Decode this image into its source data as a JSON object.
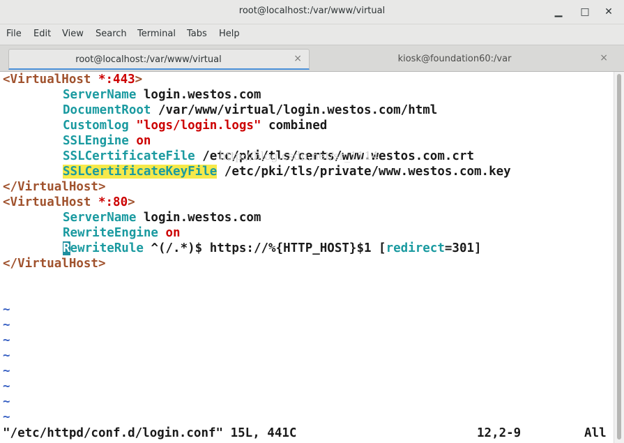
{
  "window": {
    "title": "root@localhost:/var/www/virtual",
    "minimize": "▁",
    "maximize": "□",
    "close": "✕"
  },
  "menu": [
    "File",
    "Edit",
    "View",
    "Search",
    "Terminal",
    "Tabs",
    "Help"
  ],
  "tabs": [
    {
      "label": "root@localhost:/var/www/virtual",
      "close": "×",
      "active": true
    },
    {
      "label": "kiosk@foundation60:/var",
      "close": "×",
      "active": false
    }
  ],
  "editor": {
    "l1": {
      "open": "<VirtualHost ",
      "port": "*:443",
      "end": ">"
    },
    "l2": {
      "key": "ServerName",
      "val": " login.westos.com"
    },
    "l3": {
      "key": "DocumentRoot",
      "val": " /var/www/virtual/login.westos.com/html"
    },
    "l4": {
      "key": "Customlog",
      "sp": " ",
      "str": "\"logs/login.logs\"",
      "val": " combined"
    },
    "l5": {
      "key": "SSLEngine",
      "val": " on"
    },
    "l6": {
      "key": "SSLCertificateFile",
      "val": " /etc/pki/tls/certs/www.westos.com.crt"
    },
    "l7": {
      "key": "SSLCertificateKeyFile",
      "val": " /etc/pki/tls/private/www.westos.com.key"
    },
    "l8": {
      "text": "</VirtualHost>"
    },
    "l9": {
      "open": "<VirtualHost ",
      "port": "*:80",
      "end": ">"
    },
    "l10": {
      "key": "ServerName",
      "val": " login.westos.com"
    },
    "l11": {
      "key": "RewriteEngine",
      "val": " on"
    },
    "l12": {
      "cursor": "R",
      "key": "ewriteRule",
      "mid": " ^(/.*)$ https://%{HTTP_HOST}$1 [",
      "flag": "redirect",
      "tail": "=301]"
    },
    "l13": {
      "text": "</VirtualHost>"
    },
    "tilde": "~"
  },
  "watermark": "http://blog.csdn.net/sr_1114",
  "status": {
    "file": "\"/etc/httpd/conf.d/login.conf\" 15L, 441C",
    "position": "12,2-9",
    "view": "All"
  },
  "colors": {
    "tag": "#a0522d",
    "keyword": "#1a9aa0",
    "value_red": "#cc0000",
    "search_highlight": "#f6e94a",
    "tilde": "#3b63c4"
  }
}
